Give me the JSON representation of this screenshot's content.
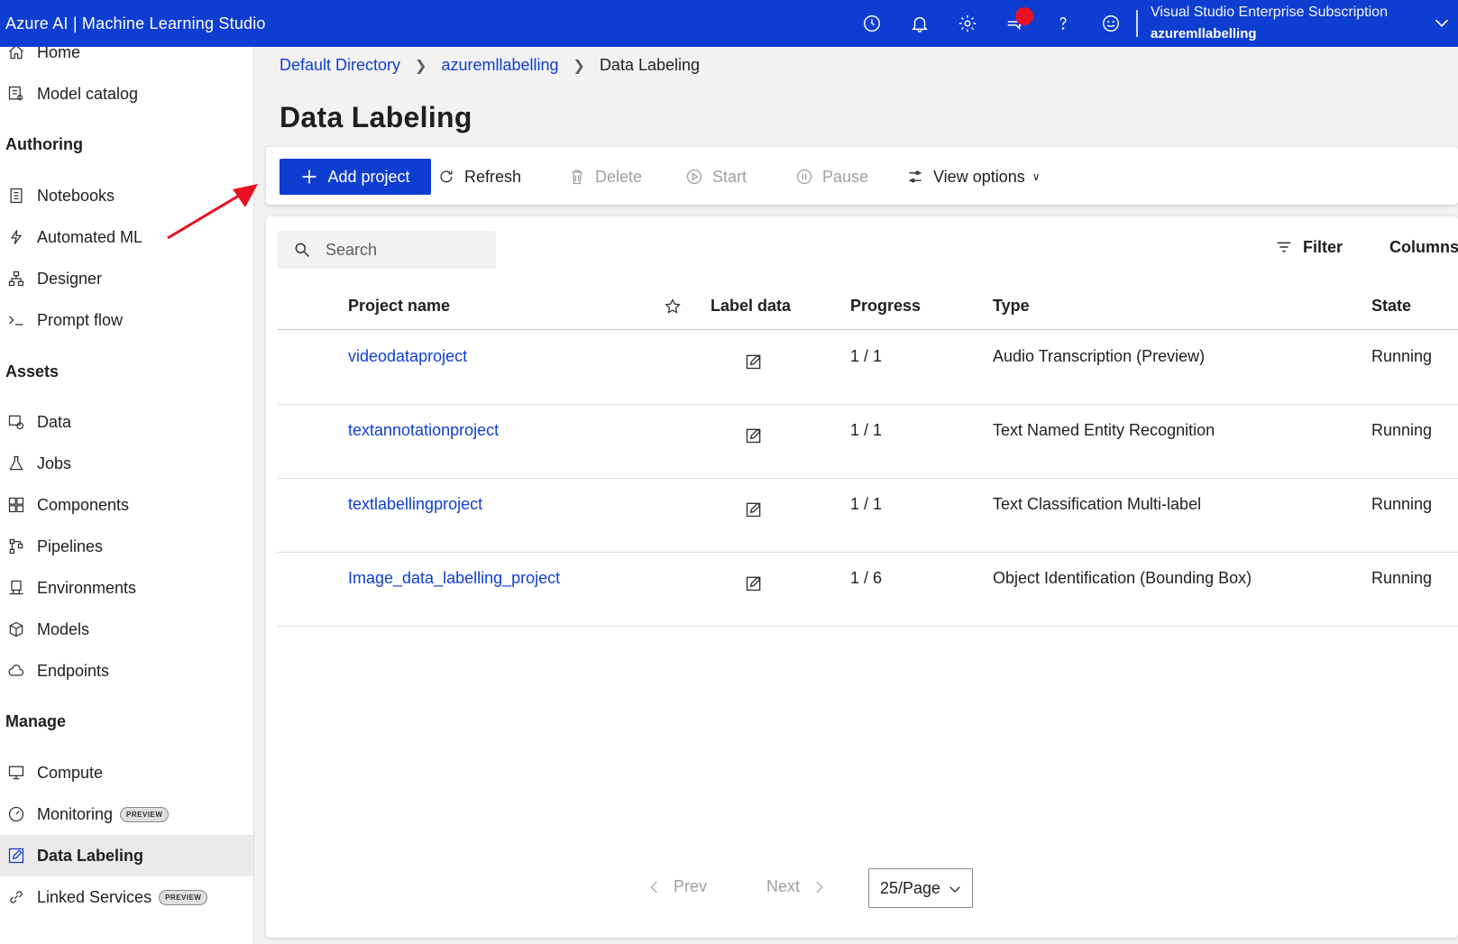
{
  "header": {
    "app_title": "Azure AI | Machine Learning Studio",
    "subscription": "Visual Studio Enterprise Subscription",
    "workspace": "azuremllabelling",
    "icons": [
      "history-icon",
      "bell-icon",
      "gear-icon",
      "feedback-icon",
      "help-icon",
      "smiley-icon"
    ]
  },
  "sidebar": {
    "top_items": [
      {
        "label": "Home",
        "icon": "home-icon"
      },
      {
        "label": "Model catalog",
        "icon": "catalog-icon"
      }
    ],
    "sections": [
      {
        "heading": "Authoring",
        "items": [
          {
            "label": "Notebooks",
            "icon": "notebook-icon"
          },
          {
            "label": "Automated ML",
            "icon": "automl-icon"
          },
          {
            "label": "Designer",
            "icon": "designer-icon"
          },
          {
            "label": "Prompt flow",
            "icon": "prompt-flow-icon"
          }
        ]
      },
      {
        "heading": "Assets",
        "items": [
          {
            "label": "Data",
            "icon": "data-icon"
          },
          {
            "label": "Jobs",
            "icon": "flask-icon"
          },
          {
            "label": "Components",
            "icon": "components-icon"
          },
          {
            "label": "Pipelines",
            "icon": "pipeline-icon"
          },
          {
            "label": "Environments",
            "icon": "environment-icon"
          },
          {
            "label": "Models",
            "icon": "cube-icon"
          },
          {
            "label": "Endpoints",
            "icon": "cloud-icon"
          }
        ]
      },
      {
        "heading": "Manage",
        "items": [
          {
            "label": "Compute",
            "icon": "monitor-icon"
          },
          {
            "label": "Monitoring",
            "icon": "gauge-icon",
            "badge": "PREVIEW"
          },
          {
            "label": "Data Labeling",
            "icon": "edit-icon",
            "active": true
          },
          {
            "label": "Linked Services",
            "icon": "link-icon",
            "badge": "PREVIEW"
          }
        ]
      }
    ]
  },
  "breadcrumb": [
    "Default Directory",
    "azuremllabelling",
    "Data Labeling"
  ],
  "page_title": "Data Labeling",
  "toolbar": {
    "add_project": "Add project",
    "refresh": "Refresh",
    "delete": "Delete",
    "start": "Start",
    "pause": "Pause",
    "view_options": "View options"
  },
  "grid": {
    "search_placeholder": "Search",
    "filter_label": "Filter",
    "columns_label": "Columns",
    "headers": {
      "project_name": "Project name",
      "label_data": "Label data",
      "progress": "Progress",
      "type": "Type",
      "state": "State"
    },
    "rows": [
      {
        "name": "videodataproject",
        "progress": "1 / 1",
        "type": "Audio Transcription (Preview)",
        "state": "Running"
      },
      {
        "name": "textannotationproject",
        "progress": "1 / 1",
        "type": "Text Named Entity Recognition",
        "state": "Running"
      },
      {
        "name": "textlabellingproject",
        "progress": "1 / 1",
        "type": "Text Classification Multi-label",
        "state": "Running"
      },
      {
        "name": "Image_data_labelling_project",
        "progress": "1 / 6",
        "type": "Object Identification (Bounding Box)",
        "state": "Running"
      }
    ]
  },
  "pager": {
    "prev": "Prev",
    "next": "Next",
    "page_size": "25/Page"
  },
  "colors": {
    "brand": "#0e3ed1",
    "annotation_arrow": "#e81123"
  }
}
